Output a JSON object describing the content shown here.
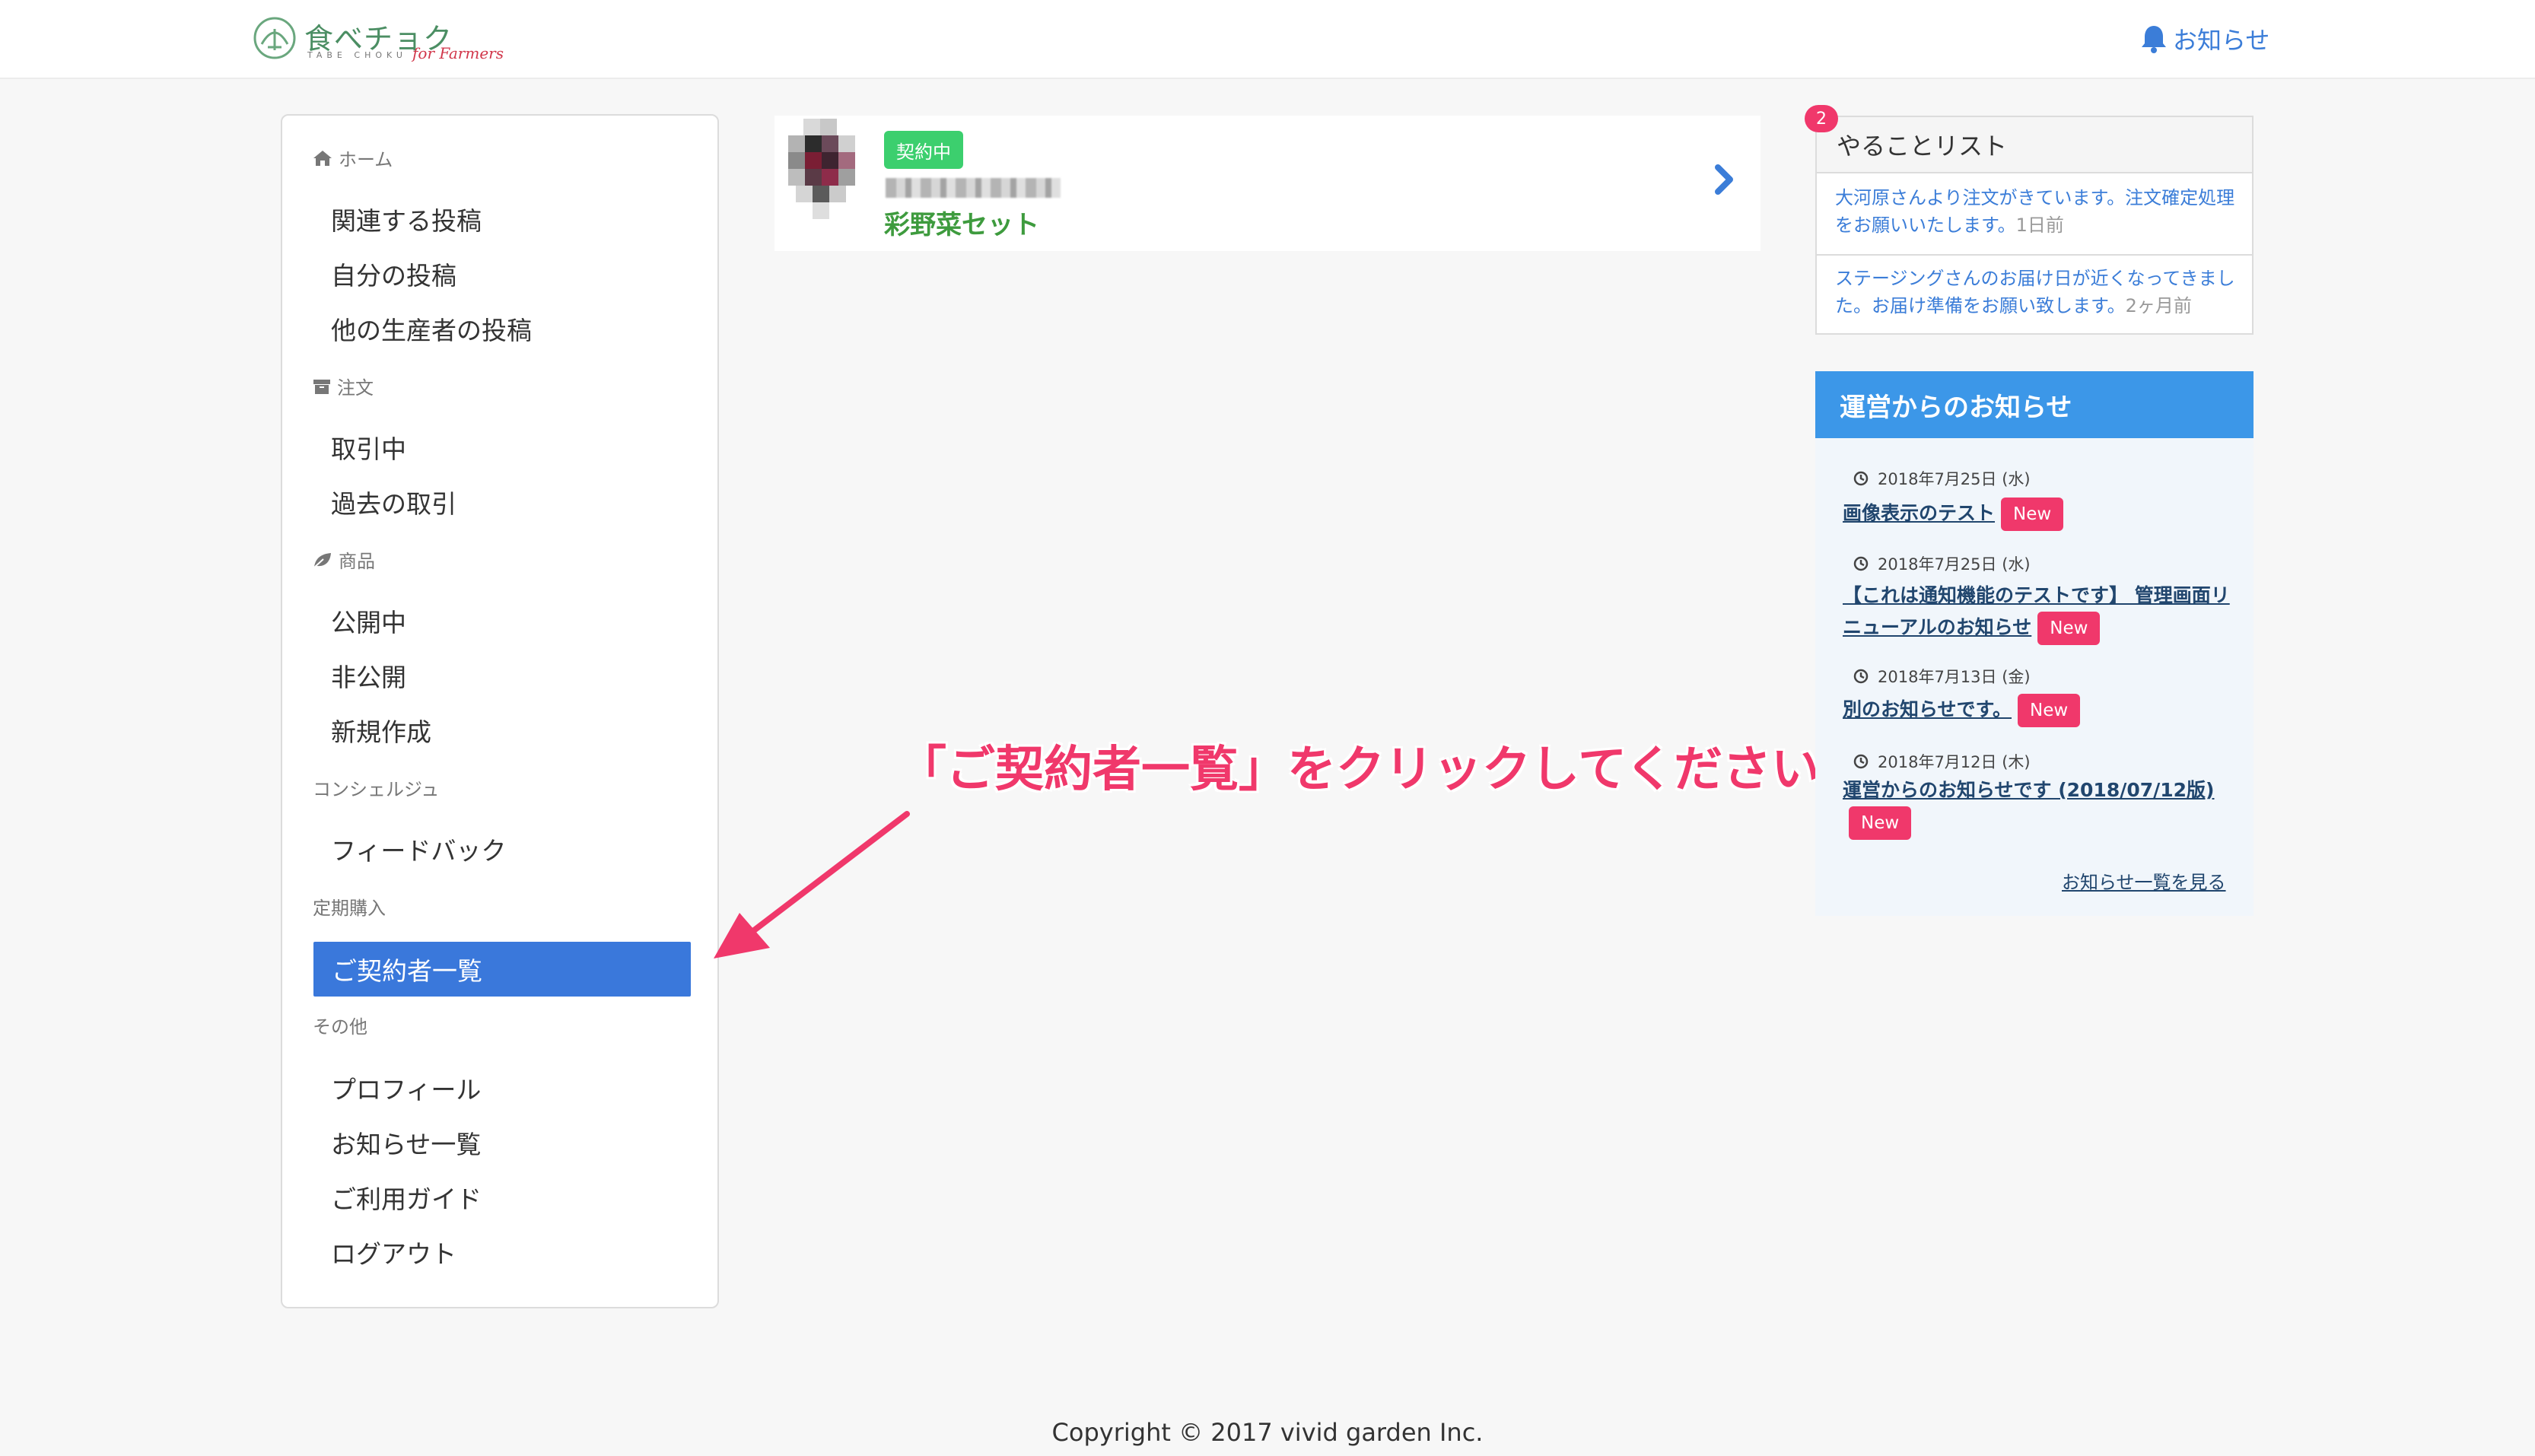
{
  "header": {
    "logo_main": "食べチョク",
    "logo_sub": "TABE CHOKU",
    "logo_script": "for Farmers",
    "notifications_label": "お知らせ"
  },
  "sidebar": {
    "sections": [
      {
        "title": "ホーム",
        "icon": "home-icon",
        "items": [
          "関連する投稿",
          "自分の投稿",
          "他の生産者の投稿"
        ]
      },
      {
        "title": "注文",
        "icon": "box-icon",
        "items": [
          "取引中",
          "過去の取引"
        ]
      },
      {
        "title": "商品",
        "icon": "leaf-icon",
        "items": [
          "公開中",
          "非公開",
          "新規作成"
        ]
      },
      {
        "title": "コンシェルジュ",
        "items": [
          "フィードバック"
        ]
      },
      {
        "title": "定期購入",
        "items": [
          "ご契約者一覧"
        ],
        "active_item": "ご契約者一覧"
      },
      {
        "title": "その他",
        "items": [
          "プロフィール",
          "お知らせ一覧",
          "ご利用ガイド",
          "ログアウト"
        ]
      }
    ]
  },
  "contract_card": {
    "status_badge": "契約中",
    "product_name": "彩野菜セット"
  },
  "annotation": {
    "text": "「ご契約者一覧」をクリックしてください。",
    "color": "#f0386b"
  },
  "todo": {
    "title": "やることリスト",
    "count": "2",
    "items": [
      {
        "text": "大河原さんより注文がきています。注文確定処理をお願いいたします。",
        "ago": "1日前"
      },
      {
        "text": "ステージングさんのお届け日が近くなってきました。お届け準備をお願い致します。",
        "ago": "2ヶ月前"
      }
    ]
  },
  "news": {
    "title": "運営からのお知らせ",
    "items": [
      {
        "date": "2018年7月25日 (水)",
        "title": "画像表示のテスト",
        "badge": "New"
      },
      {
        "date": "2018年7月25日 (水)",
        "title": "【これは通知機能のテストです】 管理画面リニューアルのお知らせ",
        "badge": "New"
      },
      {
        "date": "2018年7月13日 (金)",
        "title": "別のお知らせです。",
        "badge": "New"
      },
      {
        "date": "2018年7月12日 (木)",
        "title": "運営からのお知らせです (2018/07/12版)",
        "badge": "New"
      }
    ],
    "see_all": "お知らせ一覧を見る"
  },
  "footer": {
    "copyright": "Copyright © 2017 vivid garden Inc."
  },
  "colors": {
    "accent_blue": "#3a78db",
    "news_header": "#3c97e8",
    "badge_green": "#3ccf6e",
    "badge_pink": "#f0386b",
    "product_green": "#3e9b3e"
  }
}
